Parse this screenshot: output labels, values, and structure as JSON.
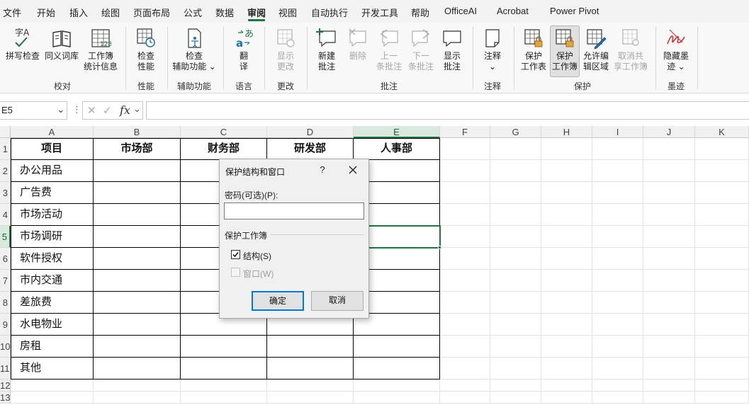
{
  "menu": {
    "tabs": [
      "文件",
      "开始",
      "插入",
      "绘图",
      "页面布局",
      "公式",
      "数据",
      "审阅",
      "视图",
      "自动执行",
      "开发工具",
      "帮助",
      "OfficeAI",
      "Acrobat",
      "Power Pivot"
    ],
    "active_tab": "审阅"
  },
  "ribbon": {
    "spelling": "拼写检查",
    "thesaurus": "同义词库",
    "workbook_stats_1": "工作簿",
    "workbook_stats_2": "统计信息",
    "check_perf_1": "检查",
    "check_perf_2": "性能",
    "check_access_1": "检查",
    "check_access_2": "辅助功能",
    "translate_1": "翻",
    "translate_2": "译",
    "show_changes_1": "显示",
    "show_changes_2": "更改",
    "new_comment_1": "新建",
    "new_comment_2": "批注",
    "delete": "删除",
    "prev_comment_1": "上一",
    "prev_comment_2": "条批注",
    "next_comment_1": "下一",
    "next_comment_2": "条批注",
    "show_comments_1": "显示",
    "show_comments_2": "批注",
    "notes": "注释",
    "protect_sheet_1": "保护",
    "protect_sheet_2": "工作表",
    "protect_wb_1": "保护",
    "protect_wb_2": "工作簿",
    "allow_edit_1": "允许编",
    "allow_edit_2": "辑区域",
    "unshare_1": "取消共",
    "unshare_2": "享工作簿",
    "hide_ink_1": "隐藏墨",
    "hide_ink_2": "迹",
    "groups": {
      "proofing": "校对",
      "performance": "性能",
      "accessibility": "辅助功能",
      "language": "语言",
      "changes": "更改",
      "comments": "批注",
      "notes": "注释",
      "protect": "保护",
      "ink": "墨迹"
    },
    "spelling_icon_text": "字A",
    "translate_icon_text": "あ"
  },
  "formula_bar": {
    "name_box": "E5",
    "fx": "fx",
    "value": ""
  },
  "grid": {
    "columns": [
      "A",
      "B",
      "C",
      "D",
      "E",
      "F",
      "G",
      "H",
      "I",
      "J",
      "K"
    ],
    "rows": [
      "1",
      "2",
      "3",
      "4",
      "5",
      "6",
      "7",
      "8",
      "9",
      "10",
      "11",
      "12",
      "13"
    ],
    "selected_cell": "E5",
    "table": {
      "headers": [
        "项目",
        "市场部",
        "财务部",
        "研发部",
        "人事部"
      ],
      "items": [
        "办公用品",
        "广告费",
        "市场活动",
        "市场调研",
        "软件授权",
        "市内交通",
        "差旅费",
        "水电物业",
        "房租",
        "其他"
      ]
    }
  },
  "dialog": {
    "title": "保护结构和窗口",
    "help": "?",
    "password_label": "密码(可选)(P):",
    "password_value": "",
    "section": "保护工作簿",
    "structure_label": "结构(S)",
    "structure_checked": true,
    "window_label": "窗口(W)",
    "window_checked": false,
    "ok": "确定",
    "cancel": "取消"
  },
  "colors": {
    "accent": "#217346",
    "button_focus": "#0078d7"
  }
}
